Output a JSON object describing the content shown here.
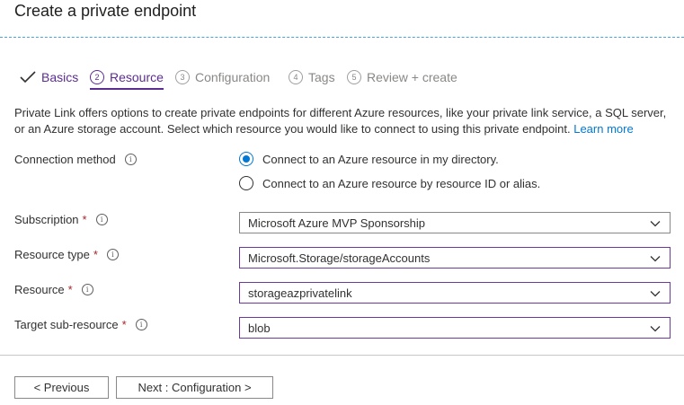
{
  "page": {
    "title": "Create a private endpoint"
  },
  "tabs": [
    {
      "number": "",
      "label": "Basics",
      "state": "completed"
    },
    {
      "number": "2",
      "label": "Resource",
      "state": "active"
    },
    {
      "number": "3",
      "label": "Configuration",
      "state": "inactive"
    },
    {
      "number": "4",
      "label": "Tags",
      "state": "inactive"
    },
    {
      "number": "5",
      "label": "Review + create",
      "state": "inactive"
    }
  ],
  "description": {
    "text": "Private Link offers options to create private endpoints for different Azure resources, like your private link service, a SQL server, or an Azure storage account. Select which resource you would like to connect to using this private endpoint.",
    "link": "Learn more"
  },
  "form": {
    "connection_method": {
      "label": "Connection method",
      "options": [
        {
          "label": "Connect to an Azure resource in my directory.",
          "selected": true
        },
        {
          "label": "Connect to an Azure resource by resource ID or alias.",
          "selected": false
        }
      ]
    },
    "subscription": {
      "label": "Subscription",
      "required": "*",
      "value": "Microsoft Azure MVP Sponsorship"
    },
    "resource_type": {
      "label": "Resource type",
      "required": "*",
      "value": "Microsoft.Storage/storageAccounts"
    },
    "resource": {
      "label": "Resource",
      "required": "*",
      "value": "storageazprivatelink"
    },
    "target_sub_resource": {
      "label": "Target sub-resource",
      "required": "*",
      "value": "blob"
    }
  },
  "footer": {
    "previous_label": "< Previous",
    "next_label": "Next : Configuration >"
  },
  "colors": {
    "accent_purple": "#5c2d91",
    "link_blue": "#0078d4",
    "required_red": "#a4262c"
  },
  "icons": {
    "check": "checkmark-icon",
    "info": "info-icon",
    "chevron": "chevron-down-icon"
  }
}
